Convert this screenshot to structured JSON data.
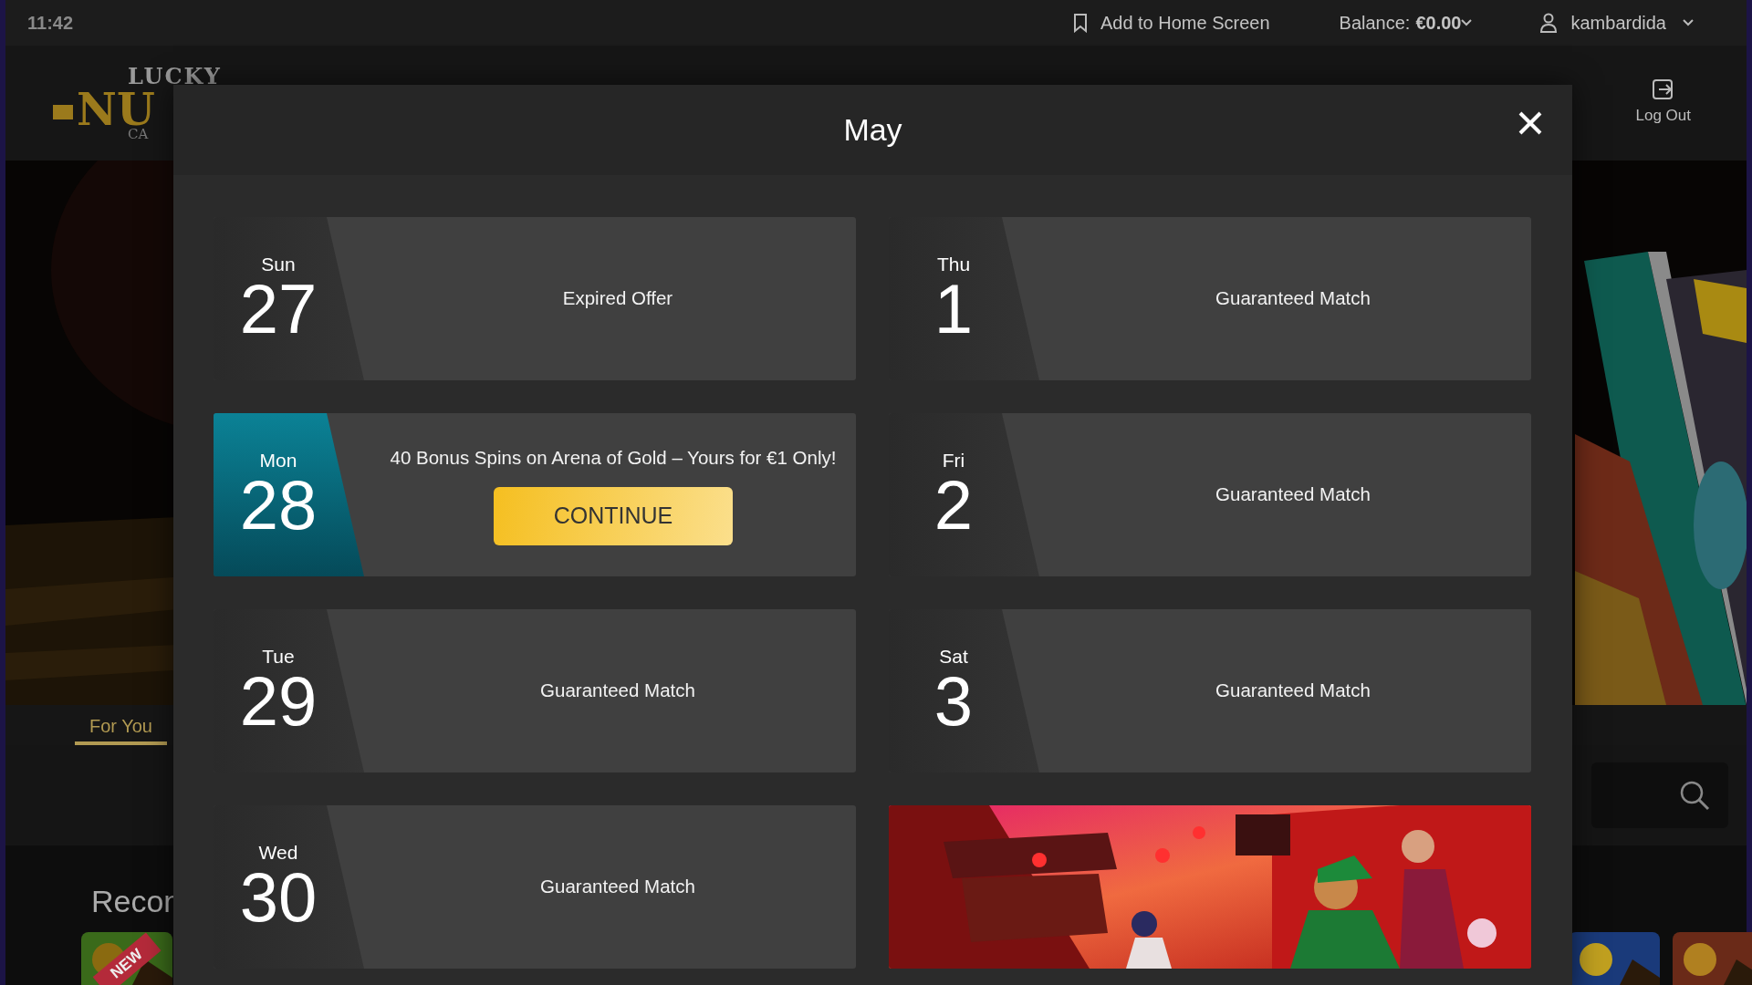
{
  "status_bar": {
    "time": "11:42",
    "add_to_home": "Add to Home Screen",
    "balance_label": "Balance:",
    "balance_value": "€0.00",
    "username": "kambardida"
  },
  "header": {
    "logo_lines": [
      "LUCKY",
      "NU",
      "CA"
    ],
    "logout": "Log Out"
  },
  "hero": {
    "kind": "picture"
  },
  "tabs": [
    {
      "label": "For You",
      "selected": true
    }
  ],
  "section_title": "Recon",
  "thumbnails": [
    {
      "kind": "picture",
      "ribbon": "NEW"
    },
    {
      "kind": "picture"
    },
    {
      "kind": "picture"
    }
  ],
  "modal": {
    "title": "May",
    "days": [
      {
        "weekday": "Sun",
        "day": "27",
        "offer": "Expired Offer",
        "selected": false
      },
      {
        "weekday": "Mon",
        "day": "28",
        "offer": "40 Bonus Spins on Arena of Gold – Yours for €1 Only!",
        "button": "CONTINUE",
        "selected": true
      },
      {
        "weekday": "Tue",
        "day": "29",
        "offer": "Guaranteed Match",
        "selected": false
      },
      {
        "weekday": "Wed",
        "day": "30",
        "offer": "Guaranteed Match",
        "selected": false
      },
      {
        "weekday": "Thu",
        "day": "1",
        "offer": "Guaranteed Match",
        "selected": false
      },
      {
        "weekday": "Fri",
        "day": "2",
        "offer": "Guaranteed Match",
        "selected": false
      },
      {
        "weekday": "Sat",
        "day": "3",
        "offer": "Guaranteed Match",
        "selected": false
      }
    ],
    "banner": {
      "kind": "picture"
    }
  }
}
